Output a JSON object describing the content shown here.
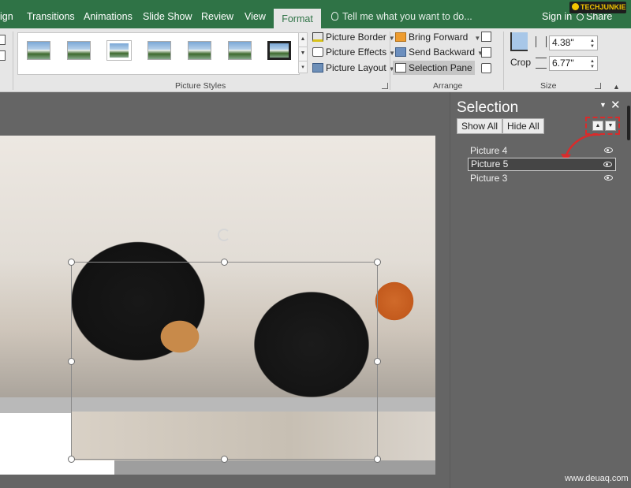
{
  "tabs": {
    "design_partial": "ign",
    "transitions": "Transitions",
    "animations": "Animations",
    "slide_show": "Slide Show",
    "review": "Review",
    "view": "View",
    "format": "Format"
  },
  "tell_me": "Tell me what you want to do...",
  "account": {
    "sign_in": "Sign in",
    "share": "Share"
  },
  "ribbon": {
    "picture_styles": {
      "label": "Picture Styles",
      "border": "Picture Border",
      "effects": "Picture Effects",
      "layout": "Picture Layout"
    },
    "arrange": {
      "label": "Arrange",
      "bring_forward": "Bring Forward",
      "send_backward": "Send Backward",
      "selection_pane": "Selection Pane"
    },
    "size": {
      "label": "Size",
      "crop": "Crop",
      "height": "4.38\"",
      "width": "6.77\""
    }
  },
  "selection_pane": {
    "title": "Selection",
    "show_all": "Show All",
    "hide_all": "Hide All",
    "items": [
      {
        "name": "Picture 4",
        "selected": false
      },
      {
        "name": "Picture 5",
        "selected": true
      },
      {
        "name": "Picture 3",
        "selected": false
      }
    ]
  },
  "logo": "TECHJUNKIE",
  "watermark": "www.deuaq.com",
  "colors": {
    "tab_bar": "#2f7346",
    "ribbon_bg": "#e6e6e6",
    "pane_bg": "#656565",
    "highlight_dashed": "#d92b2b"
  }
}
